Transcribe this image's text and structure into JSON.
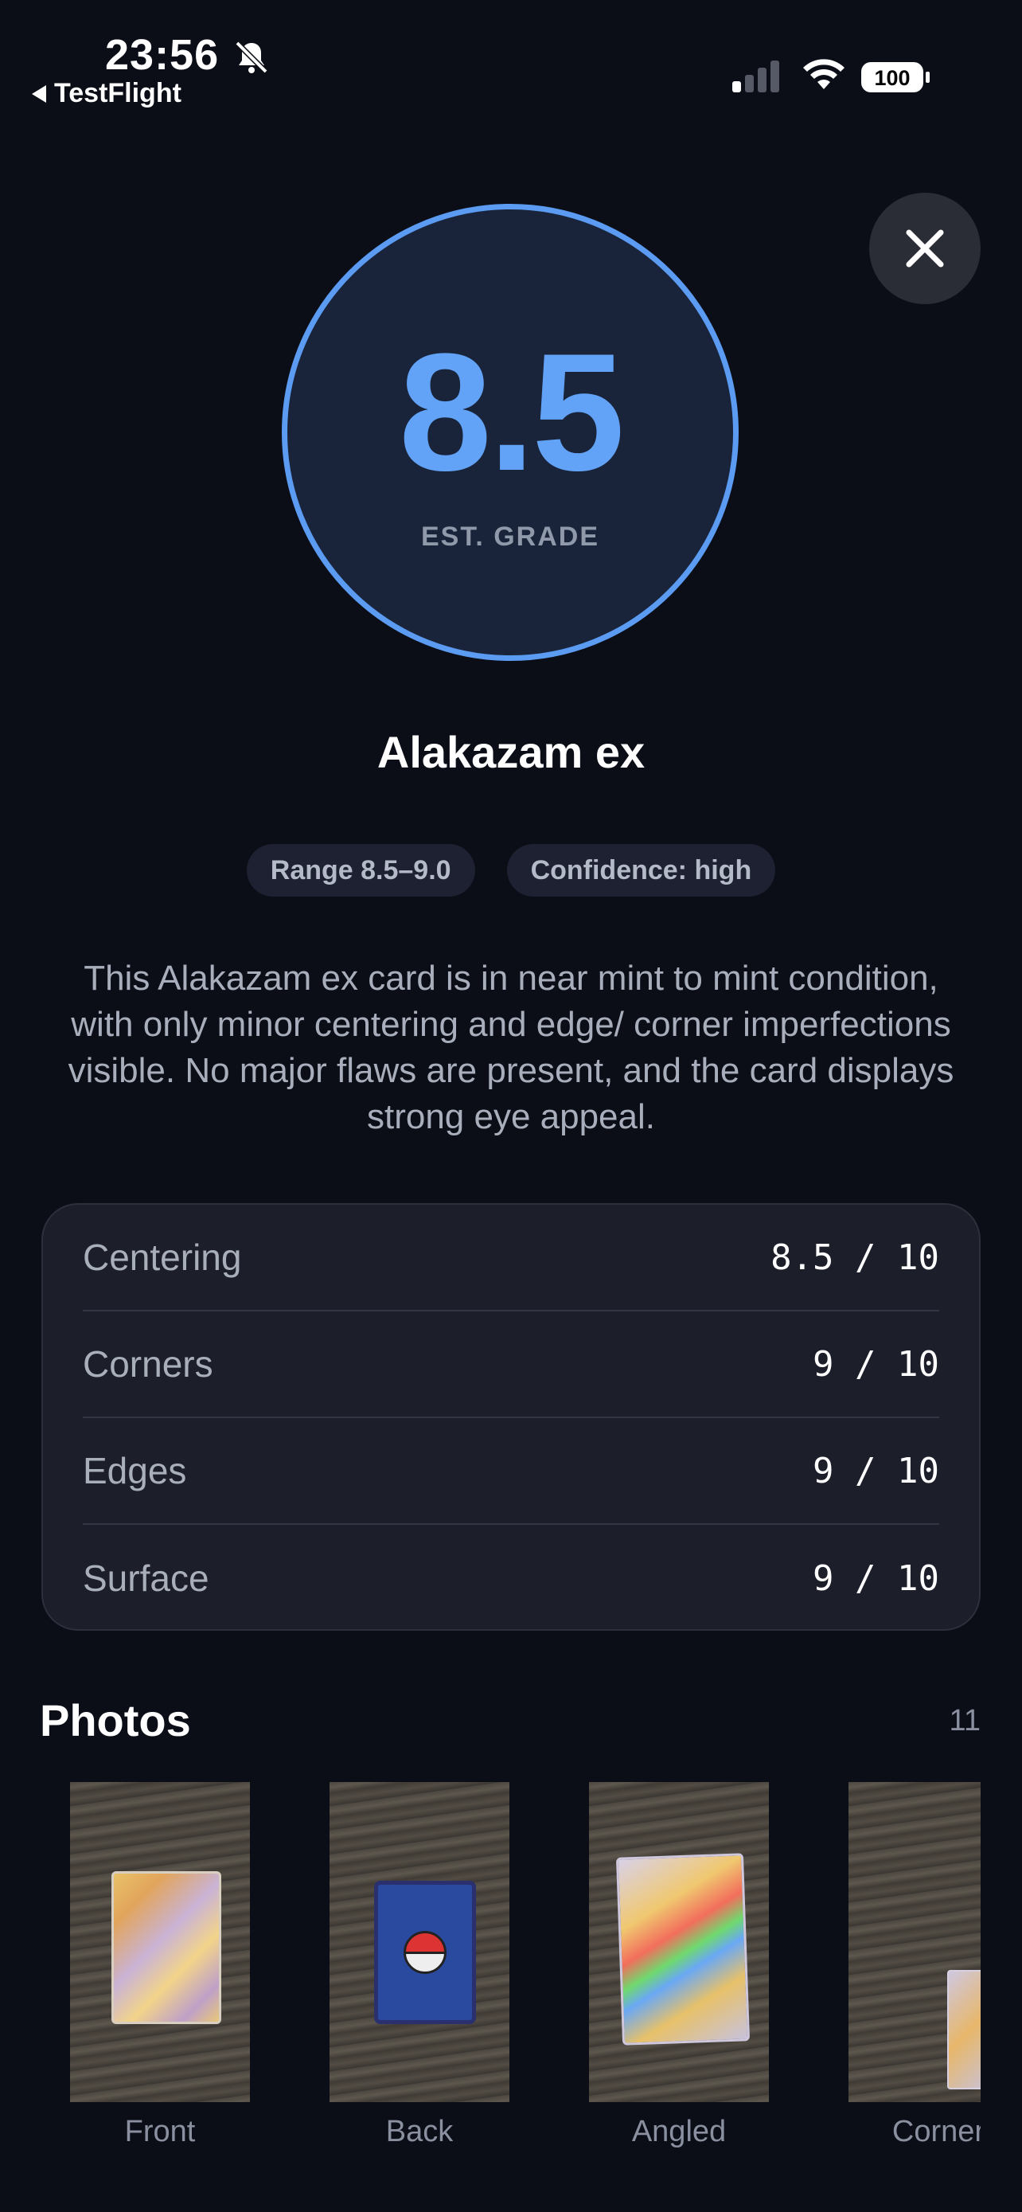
{
  "status_bar": {
    "time": "23:56",
    "back_app": "TestFlight",
    "battery": "100"
  },
  "grade": {
    "value": "8.5",
    "label": "EST. GRADE"
  },
  "card_name": "Alakazam ex",
  "chips": {
    "range": "Range 8.5–9.0",
    "confidence": "Confidence: high"
  },
  "summary": "This Alakazam ex card is in near mint to mint condition, with only minor centering and edge/ corner imperfections visible. No major flaws are present, and the card displays strong eye appeal.",
  "scores": [
    {
      "label": "Centering",
      "value": "8.5 / 10"
    },
    {
      "label": "Corners",
      "value": "9 / 10"
    },
    {
      "label": "Edges",
      "value": "9 / 10"
    },
    {
      "label": "Surface",
      "value": "9 / 10"
    }
  ],
  "photos": {
    "title": "Photos",
    "count": "11",
    "items": [
      {
        "label": "Front"
      },
      {
        "label": "Back"
      },
      {
        "label": "Angled"
      },
      {
        "label": "Corner"
      }
    ]
  },
  "colors": {
    "background": "#0b0e17",
    "accent": "#62a3f7",
    "circle_fill": "#19243a",
    "panel": "#1c1f2a"
  },
  "icons": {
    "close": "close-icon",
    "silent": "bell-slash-icon",
    "signal": "cellular-signal-icon",
    "wifi": "wifi-icon",
    "battery": "battery-icon"
  }
}
